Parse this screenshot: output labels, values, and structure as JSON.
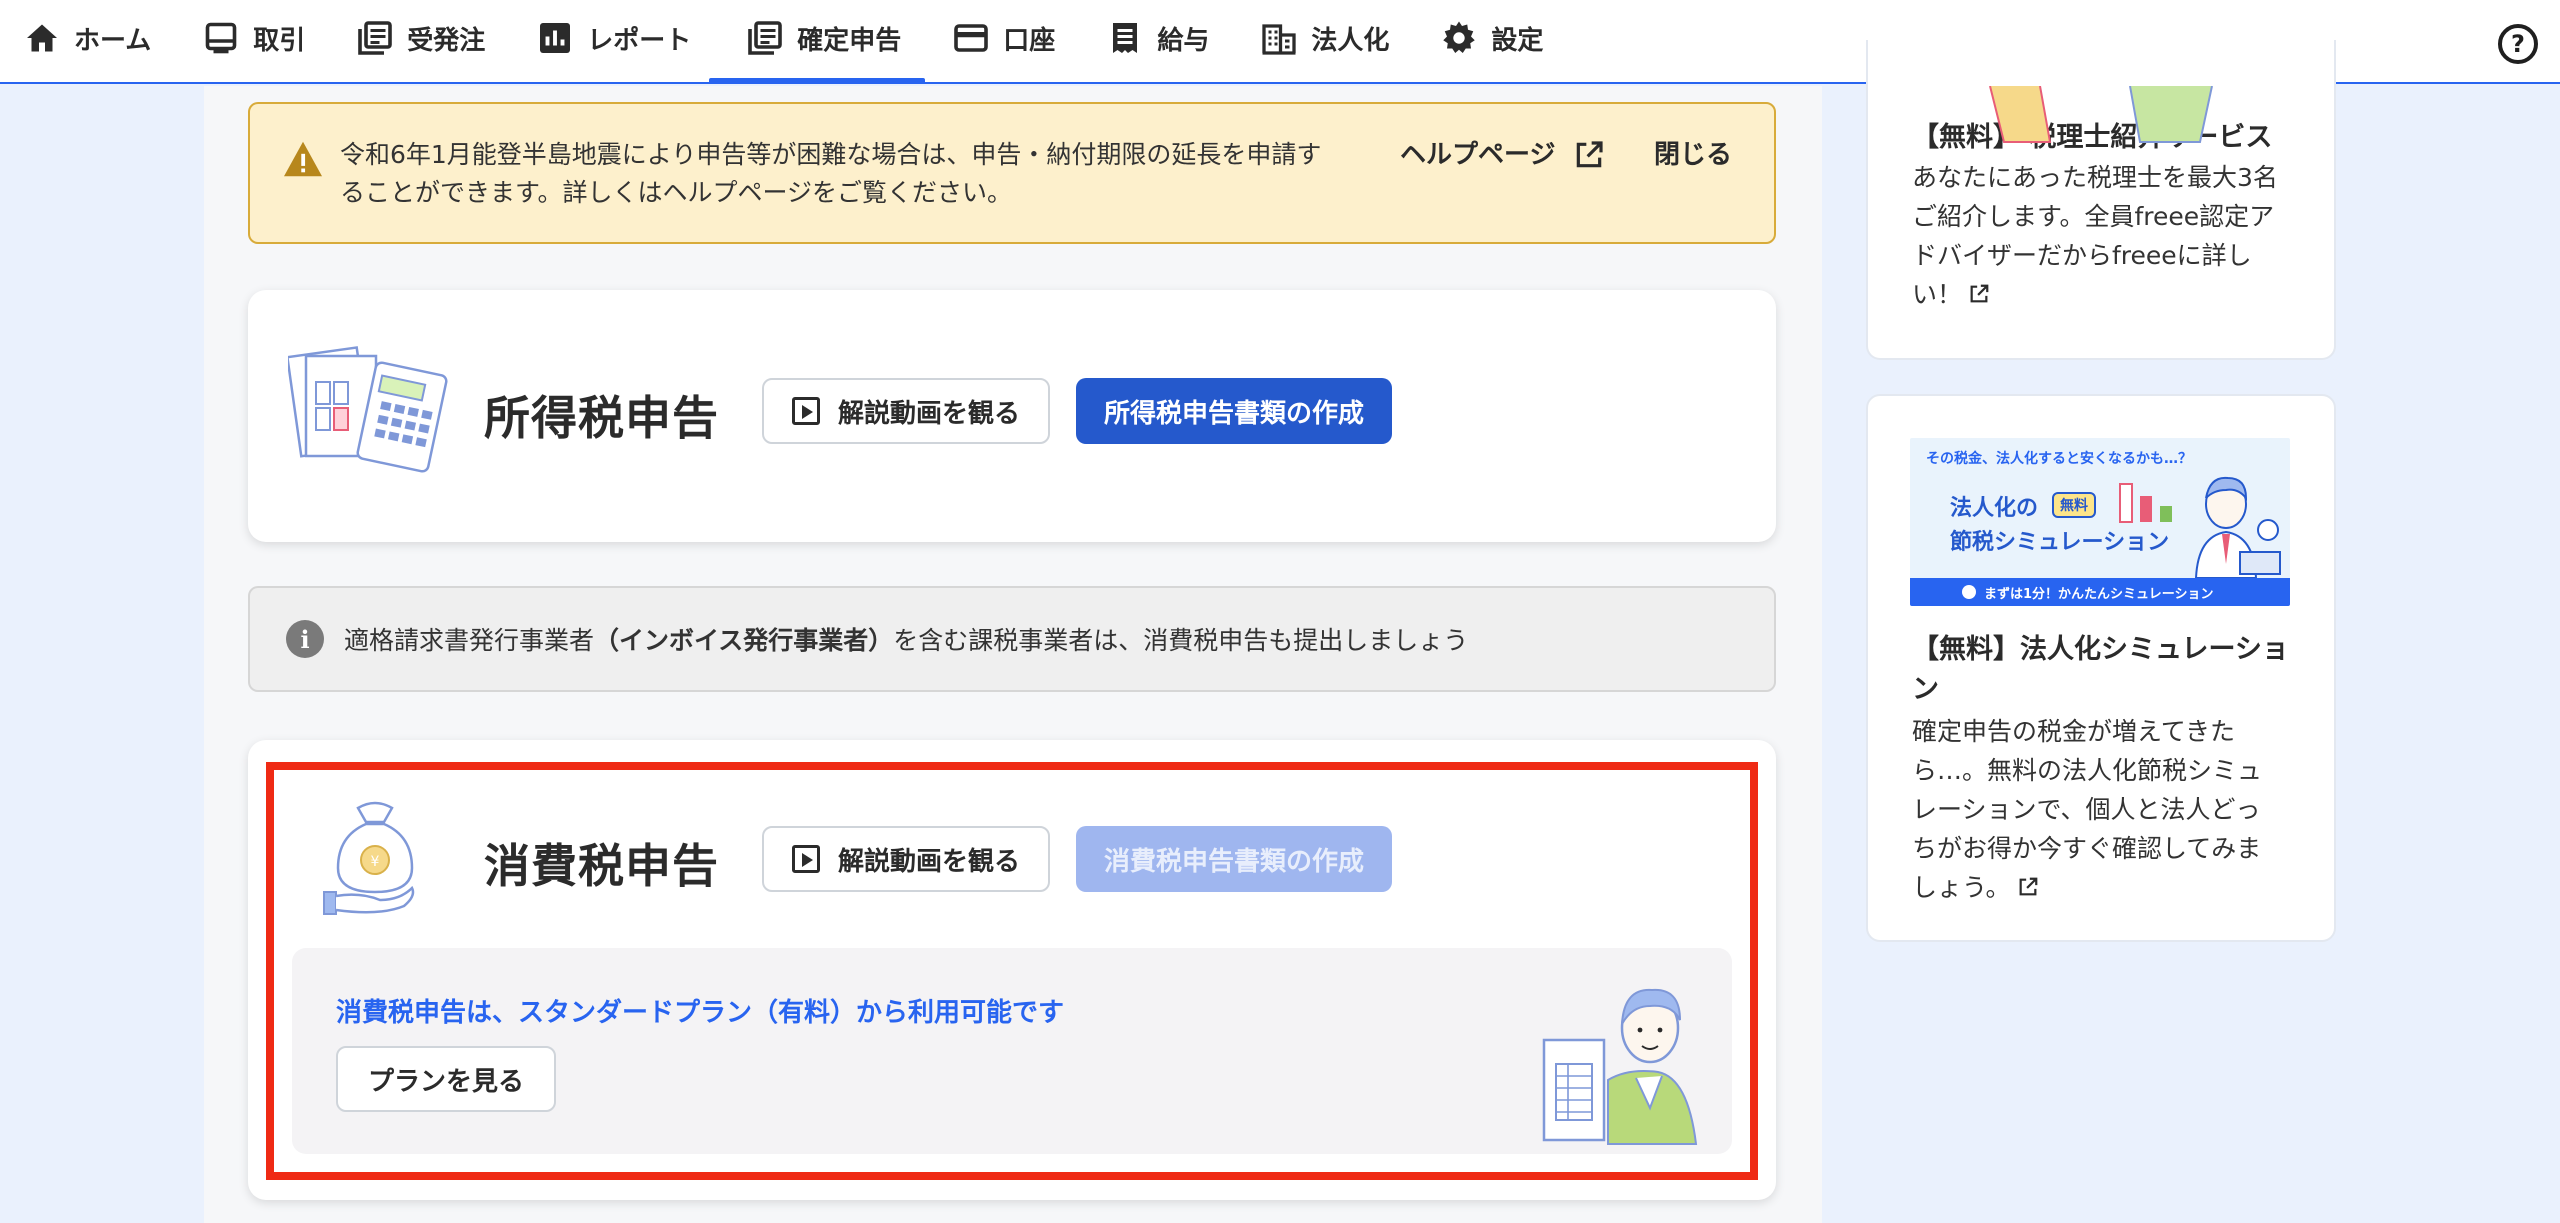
{
  "nav": {
    "items": [
      {
        "label": "ホーム",
        "icon": "home-icon"
      },
      {
        "label": "取引",
        "icon": "transaction-icon"
      },
      {
        "label": "受発注",
        "icon": "orders-icon"
      },
      {
        "label": "レポート",
        "icon": "report-icon"
      },
      {
        "label": "確定申告",
        "icon": "tax-return-icon",
        "active": true
      },
      {
        "label": "口座",
        "icon": "account-card-icon"
      },
      {
        "label": "給与",
        "icon": "payroll-icon"
      },
      {
        "label": "法人化",
        "icon": "building-icon"
      },
      {
        "label": "設定",
        "icon": "gear-icon"
      }
    ],
    "help": "?"
  },
  "alert": {
    "text": "令和6年1月能登半島地震により申告等が困難な場合は、申告・納付期限の延長を申請することができます。詳しくはヘルプページをご覧ください。",
    "help_link": "ヘルプページ",
    "close": "閉じる"
  },
  "income_tax": {
    "title": "所得税申告",
    "video_button": "解説動画を観る",
    "create_button": "所得税申告書類の作成"
  },
  "info_bar": {
    "text_before": "適格請求書発行事業者",
    "text_bold": "（インボイス発行事業者）",
    "text_after": "を含む課税事業者は、消費税申告も提出しましょう"
  },
  "consumption_tax": {
    "title": "消費税申告",
    "video_button": "解説動画を観る",
    "create_button": "消費税申告書類の作成",
    "plan_message": "消費税申告は、スタンダードプラン（有料）から利用可能です",
    "plan_button": "プランを見る"
  },
  "promo_1": {
    "title": "【無料】 税理士紹介サービス",
    "body": "あなたにあった税理士を最大3名ご紹介します。全員freee認定アドバイザーだからfreeeに詳しい！"
  },
  "promo_2": {
    "banner": {
      "top_text": "その税金、法人化すると安くなるかも…？",
      "line1": "法人化の",
      "badge": "無料",
      "line2": "節税シミュレーション",
      "footer": "まずは1分！かんたんシミュレーション"
    },
    "title": "【無料】法人化シミュレーション",
    "body": "確定申告の税金が増えてきたら…。無料の法人化節税シミュレーションで、個人と法人どっちがお得か今すぐ確認してみましょう。"
  },
  "colors": {
    "accent": "#2864f0",
    "primary_button": "#2559cc",
    "disabled_button": "#9fb6ef",
    "highlight_frame": "#ef2a14",
    "alert_bg": "#fdf0cc"
  }
}
